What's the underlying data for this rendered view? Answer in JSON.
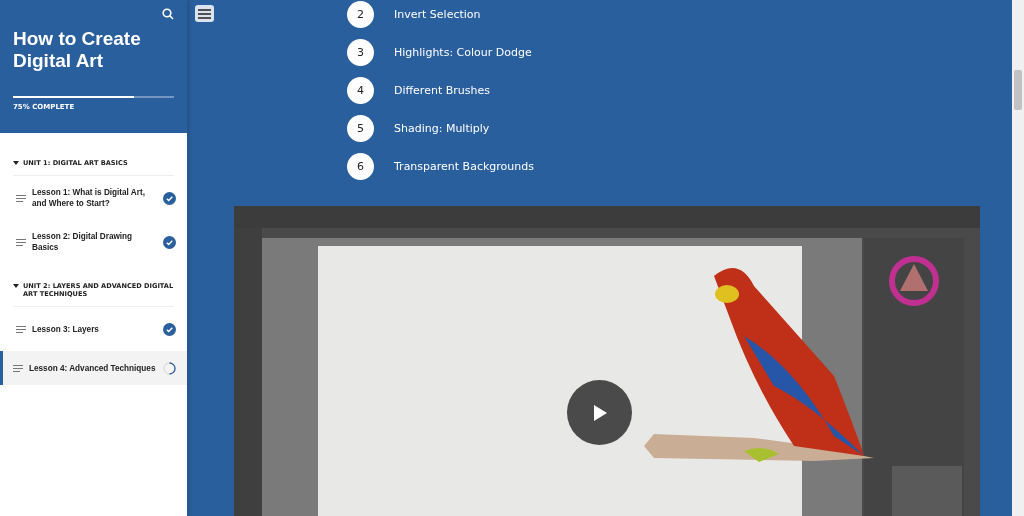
{
  "sidebar": {
    "title": "How to Create Digital Art",
    "progress": {
      "level": 0.75,
      "label": "75% COMPLETE"
    },
    "units": [
      {
        "title": "UNIT 1: DIGITAL ART BASICS",
        "expanded": true,
        "lessons": [
          {
            "title": "Lesson 1: What is Digital Art, and Where to Start?",
            "complete": true,
            "selected": false
          },
          {
            "title": "Lesson 2: Digital Drawing Basics",
            "complete": true,
            "selected": false
          }
        ]
      },
      {
        "title": "UNIT 2: LAYERS AND ADVANCED DIGITAL ART TECHNIQUES",
        "expanded": true,
        "lessons": [
          {
            "title": "Lesson 3: Layers",
            "complete": true,
            "selected": false
          },
          {
            "title": "Lesson 4: Advanced Techniques",
            "complete": false,
            "selected": true
          }
        ]
      }
    ]
  },
  "steps": [
    {
      "number": "2",
      "text": "Invert Selection"
    },
    {
      "number": "3",
      "text": "Highlights: Colour Dodge"
    },
    {
      "number": "4",
      "text": "Different Brushes"
    },
    {
      "number": "5",
      "text": "Shading: Multiply"
    },
    {
      "number": "6",
      "text": "Transparent Backgrounds"
    }
  ]
}
